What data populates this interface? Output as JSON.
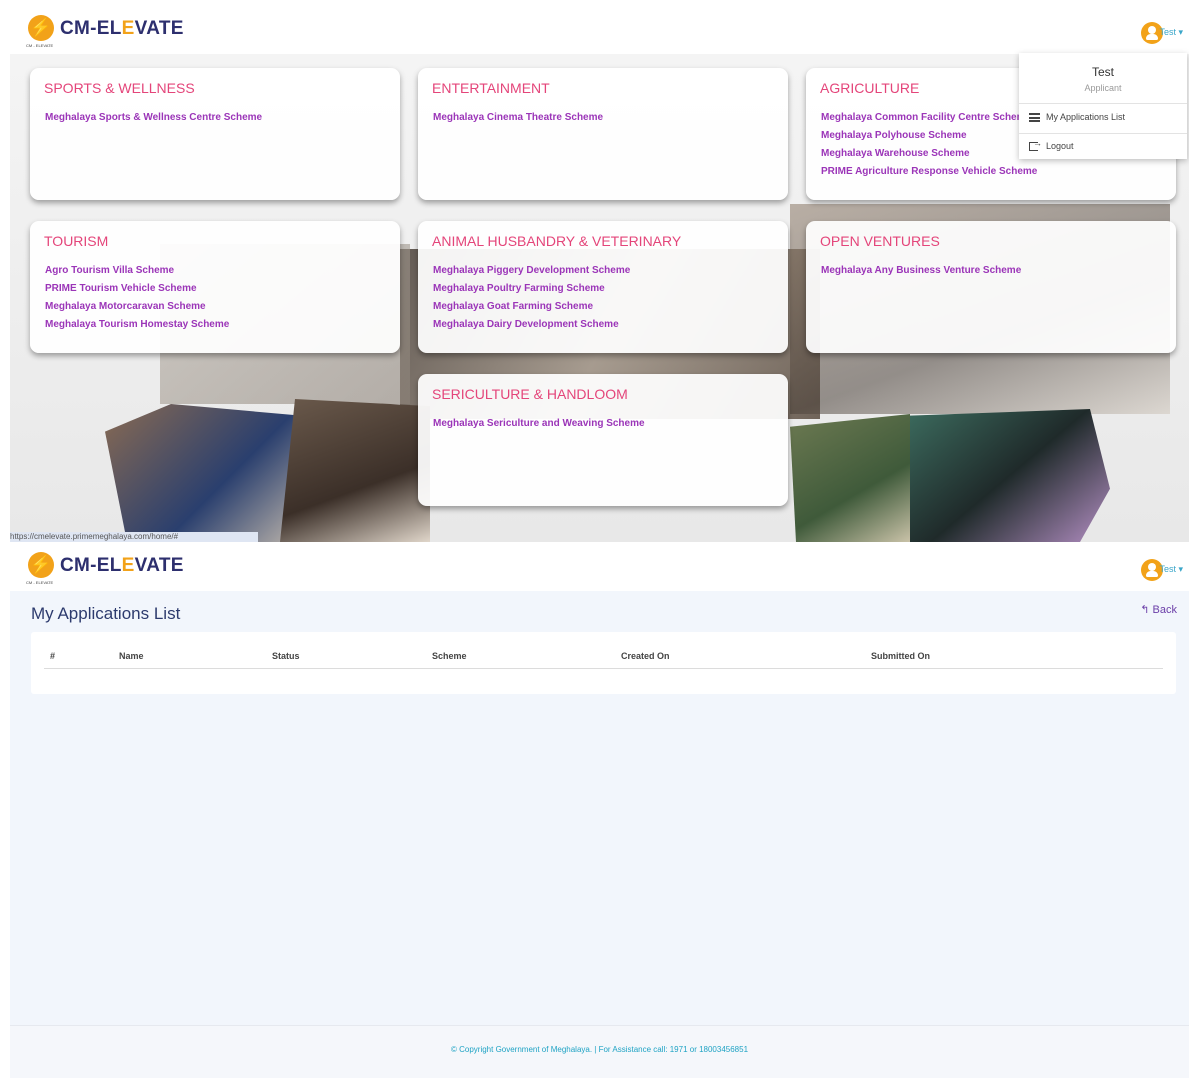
{
  "app": {
    "brand_prefix": "CM-EL",
    "brand_accent": "E",
    "brand_suffix": "VATE",
    "logo_tagline": "CM - ELEVATE"
  },
  "user": {
    "name": "Test",
    "role": "Applicant"
  },
  "dropdown": {
    "items": [
      {
        "icon": "menu-icon",
        "label": "My Applications List"
      },
      {
        "icon": "logout-icon",
        "label": "Logout"
      }
    ]
  },
  "status_url": "https://cmelevate.primemeghalaya.com/home/#",
  "categories": [
    {
      "title": "SPORTS & WELLNESS",
      "schemes": [
        "Meghalaya Sports & Wellness Centre Scheme"
      ]
    },
    {
      "title": "ENTERTAINMENT",
      "schemes": [
        "Meghalaya Cinema Theatre Scheme"
      ]
    },
    {
      "title": "AGRICULTURE",
      "schemes": [
        "Meghalaya Common Facility Centre Scheme",
        "Meghalaya Polyhouse Scheme",
        "Meghalaya Warehouse Scheme",
        "PRIME Agriculture Response Vehicle Scheme"
      ]
    },
    {
      "title": "TOURISM",
      "schemes": [
        "Agro Tourism Villa Scheme",
        "PRIME Tourism Vehicle Scheme",
        "Meghalaya Motorcaravan Scheme",
        "Meghalaya Tourism Homestay Scheme"
      ]
    },
    {
      "title": "ANIMAL HUSBANDRY & VETERINARY",
      "schemes": [
        "Meghalaya Piggery Development Scheme",
        "Meghalaya Poultry Farming Scheme",
        "Meghalaya Goat Farming Scheme",
        "Meghalaya Dairy Development Scheme"
      ]
    },
    {
      "title": "OPEN VENTURES",
      "schemes": [
        "Meghalaya Any Business Venture Scheme"
      ]
    },
    {
      "title": "SERICULTURE & HANDLOOM",
      "schemes": [
        "Meghalaya Sericulture and Weaving Scheme"
      ]
    }
  ],
  "applications": {
    "title": "My Applications List",
    "back_label": "Back",
    "columns": [
      "#",
      "Name",
      "Status",
      "Scheme",
      "Created On",
      "Submitted On"
    ],
    "rows": []
  },
  "footer": {
    "text": "© Copyright Government of Meghalaya. | For Assistance call: 1971 or 18003456851"
  },
  "colors": {
    "accent_orange": "#f2a219",
    "brand_navy": "#2d2f6e",
    "category_pink": "#e4457a",
    "scheme_purple": "#9b35b8"
  }
}
